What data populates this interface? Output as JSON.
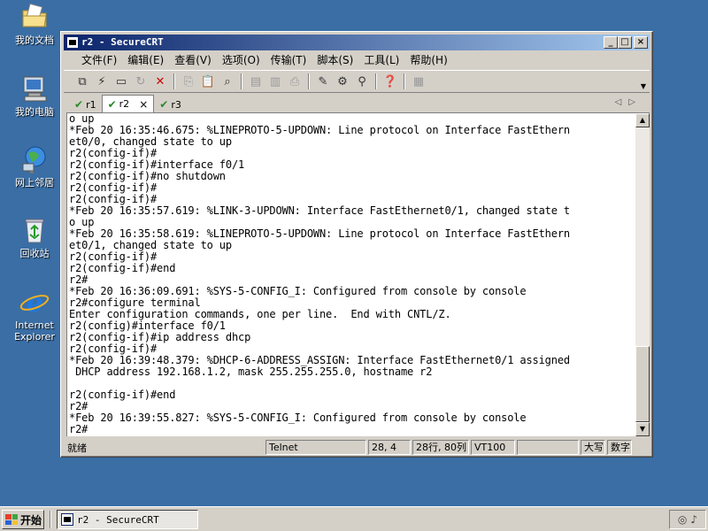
{
  "desktop": {
    "icons": [
      {
        "label": "我的文档",
        "icon": "folder-documents-icon"
      },
      {
        "label": "我的电脑",
        "icon": "computer-icon"
      },
      {
        "label": "网上邻居",
        "icon": "network-icon"
      },
      {
        "label": "回收站",
        "icon": "recycle-bin-icon"
      },
      {
        "label": "Internet\nExplorer",
        "icon": "ie-icon"
      }
    ]
  },
  "window": {
    "title": "r2 - SecureCRT",
    "controls": {
      "minimize": "_",
      "maximize": "□",
      "close": "×"
    },
    "menu": [
      "文件(F)",
      "编辑(E)",
      "查看(V)",
      "选项(O)",
      "传输(T)",
      "脚本(S)",
      "工具(L)",
      "帮助(H)"
    ],
    "tabs": [
      {
        "label": "r1",
        "active": false
      },
      {
        "label": "r2",
        "active": true,
        "close": "×"
      },
      {
        "label": "r3",
        "active": false
      }
    ],
    "terminal_lines": [
      "o up",
      "*Feb 20 16:35:46.675: %LINEPROTO-5-UPDOWN: Line protocol on Interface FastEthern",
      "et0/0, changed state to up",
      "r2(config-if)#",
      "r2(config-if)#interface f0/1",
      "r2(config-if)#no shutdown",
      "r2(config-if)#",
      "r2(config-if)#",
      "*Feb 20 16:35:57.619: %LINK-3-UPDOWN: Interface FastEthernet0/1, changed state t",
      "o up",
      "*Feb 20 16:35:58.619: %LINEPROTO-5-UPDOWN: Line protocol on Interface FastEthern",
      "et0/1, changed state to up",
      "r2(config-if)#",
      "r2(config-if)#end",
      "r2#",
      "*Feb 20 16:36:09.691: %SYS-5-CONFIG_I: Configured from console by console",
      "r2#configure terminal",
      "Enter configuration commands, one per line.  End with CNTL/Z.",
      "r2(config)#interface f0/1",
      "r2(config-if)#ip address dhcp",
      "r2(config-if)#",
      "*Feb 20 16:39:48.379: %DHCP-6-ADDRESS_ASSIGN: Interface FastEthernet0/1 assigned",
      " DHCP address 192.168.1.2, mask 255.255.255.0, hostname r2",
      "",
      "r2(config-if)#end",
      "r2#",
      "*Feb 20 16:39:55.827: %SYS-5-CONFIG_I: Configured from console by console",
      "r2#"
    ],
    "status": {
      "ready": "就绪",
      "protocol": "Telnet",
      "cursor": "28,  4",
      "size": "28行, 80列",
      "emulation": "VT100",
      "blank": "",
      "caps": "大写",
      "num": "数字"
    }
  },
  "taskbar": {
    "start": "开始",
    "task": "r2 - SecureCRT"
  }
}
